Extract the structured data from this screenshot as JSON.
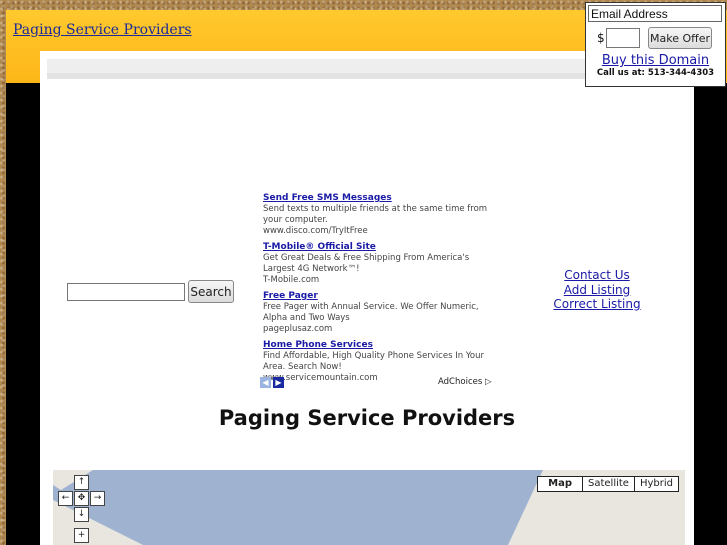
{
  "header": {
    "site_link": "Paging Service Providers"
  },
  "search": {
    "placeholder": "",
    "button_label": "Search"
  },
  "ads": [
    {
      "title": "Send Free SMS Messages",
      "desc": "Send texts to multiple friends at the same time from your computer.",
      "url": "www.disco.com/TryItFree"
    },
    {
      "title": "T-Mobile® Official Site",
      "desc": "Get Great Deals & Free Shipping From America's Largest 4G Network™!",
      "url": "T-Mobile.com"
    },
    {
      "title": "Free Pager",
      "desc": "Free Pager with Annual Service. We Offer Numeric, Alpha and Two Ways",
      "url": "pageplusaz.com"
    },
    {
      "title": "Home Phone Services",
      "desc": "Find Affordable, High Quality Phone Services In Your Area. Search Now!",
      "url": "www.servicemountain.com"
    }
  ],
  "ad_nav": {
    "prev": "◀",
    "next": "▶",
    "adchoices": "AdChoices ▷"
  },
  "contact": {
    "contact_us": "Contact Us",
    "add_listing": "Add Listing",
    "correct_listing": "Correct Listing"
  },
  "page_title": "Paging Service Providers",
  "map": {
    "types": [
      "Map",
      "Satellite",
      "Hybrid"
    ],
    "active": "Map",
    "controls": {
      "up": "↑",
      "left": "←",
      "center": "✥",
      "right": "→",
      "down": "↓",
      "zoom_in": "+"
    },
    "water_color": "#9fb3d1",
    "land_color": "#e9e6df"
  },
  "offer": {
    "email_placeholder": "Email Address",
    "currency": "$",
    "make_offer_label": "Make Offer",
    "buy_domain": "Buy this Domain",
    "call_us": "Call us at: 513-344-4303"
  },
  "colors": {
    "header": "#ffc92e",
    "link": "#1a1aa6"
  }
}
